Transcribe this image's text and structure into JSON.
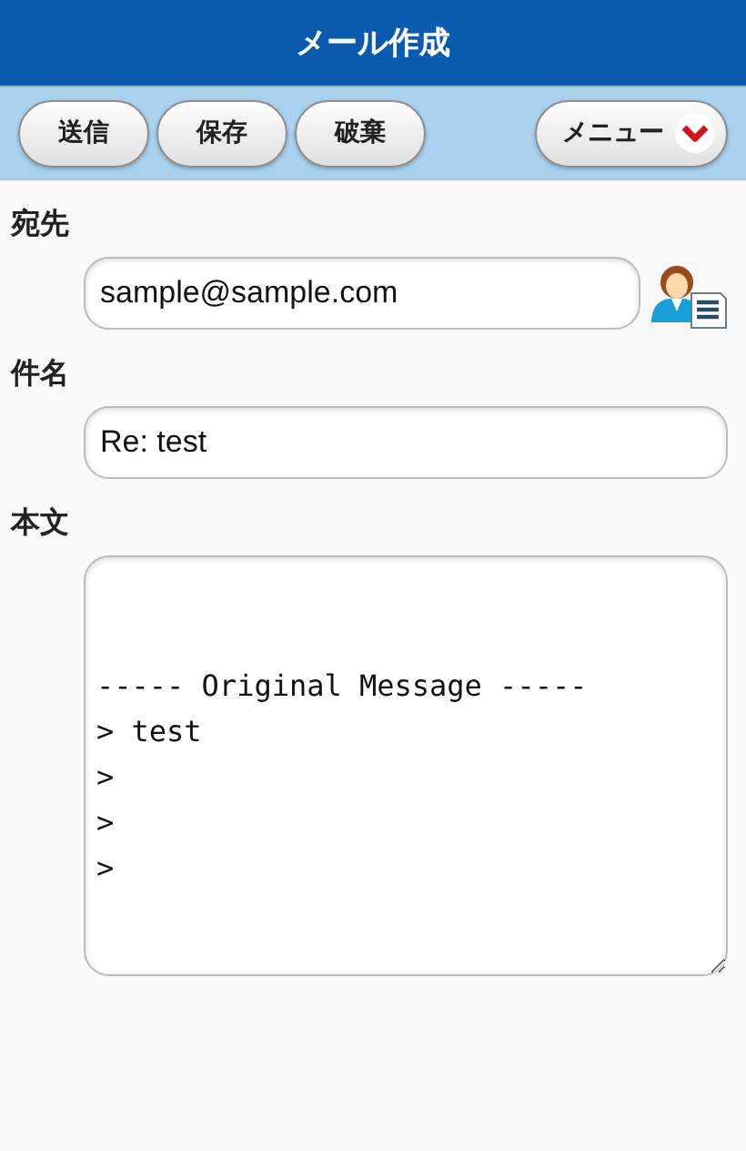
{
  "header": {
    "title": "メール作成"
  },
  "toolbar": {
    "buttons": [
      "送信",
      "保存",
      "破棄"
    ],
    "menu": "メニュー"
  },
  "fields": [
    {
      "label": "宛先",
      "value": "sample@sample.com",
      "kind": "address"
    },
    {
      "label": "件名",
      "value": "Re: test",
      "kind": "text"
    },
    {
      "label": "本文",
      "value": "\n\n----- Original Message -----\n> test\n>\n>\n>",
      "kind": "body"
    }
  ]
}
